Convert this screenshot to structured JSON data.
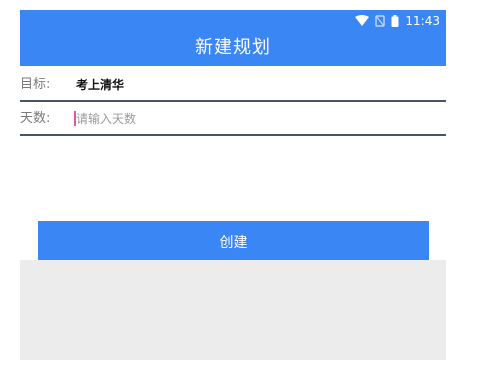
{
  "status_bar": {
    "time": "11:43",
    "icons": [
      "wifi-icon",
      "no-sim-icon",
      "battery-icon"
    ]
  },
  "toolbar": {
    "title": "新建规划"
  },
  "form": {
    "goal_label": "目标:",
    "goal_value": "考上清华",
    "days_label": "天数:",
    "days_value": "",
    "days_placeholder": "请输入天数"
  },
  "actions": {
    "create_label": "创建"
  },
  "colors": {
    "primary": "#3a86f5",
    "divider": "#4a5563",
    "caret": "#e056a0",
    "panel": "#ececec"
  }
}
